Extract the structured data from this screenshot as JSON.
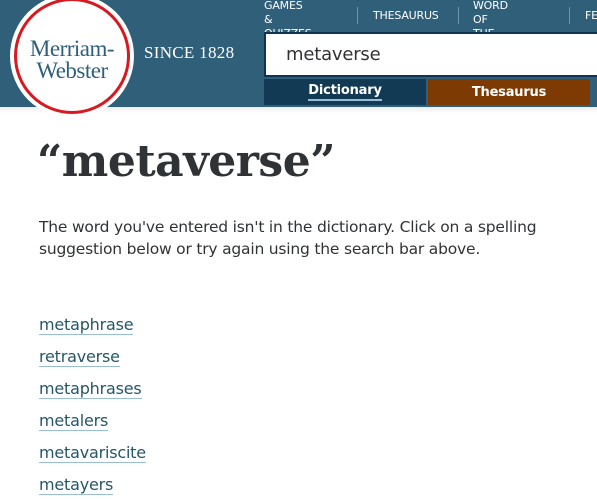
{
  "brand": {
    "logo_line1": "Merriam-",
    "logo_line2": "Webster",
    "tagline": "SINCE 1828"
  },
  "nav": {
    "items": [
      {
        "label": "GAMES & QUIZZES",
        "line1": "GAMES &",
        "line2": "QUIZZES"
      },
      {
        "label": "THESAURUS"
      },
      {
        "label": "WORD OF THE DAY",
        "line1": "WORD OF",
        "line2": "THE DAY"
      },
      {
        "label": "FE"
      }
    ]
  },
  "search": {
    "value": "metaverse",
    "placeholder": ""
  },
  "search_tabs": [
    {
      "label": "Dictionary",
      "active": true
    },
    {
      "label": "Thesaurus",
      "active": false
    }
  ],
  "main": {
    "title": "“metaverse”",
    "message": "The word you've entered isn't in the dictionary. Click on a spelling suggestion below or try again using the search bar above.",
    "suggestions": [
      "metaphrase",
      "retraverse",
      "metaphrases",
      "metalers",
      "metavariscite",
      "metayers"
    ]
  },
  "colors": {
    "header": "#305f7a",
    "dictionary_tab": "#133a54",
    "thesaurus_tab": "#7d3a03",
    "logo_ring": "#d71920",
    "link": "#265667",
    "link_underline": "#97bed4",
    "text": "#303336"
  }
}
